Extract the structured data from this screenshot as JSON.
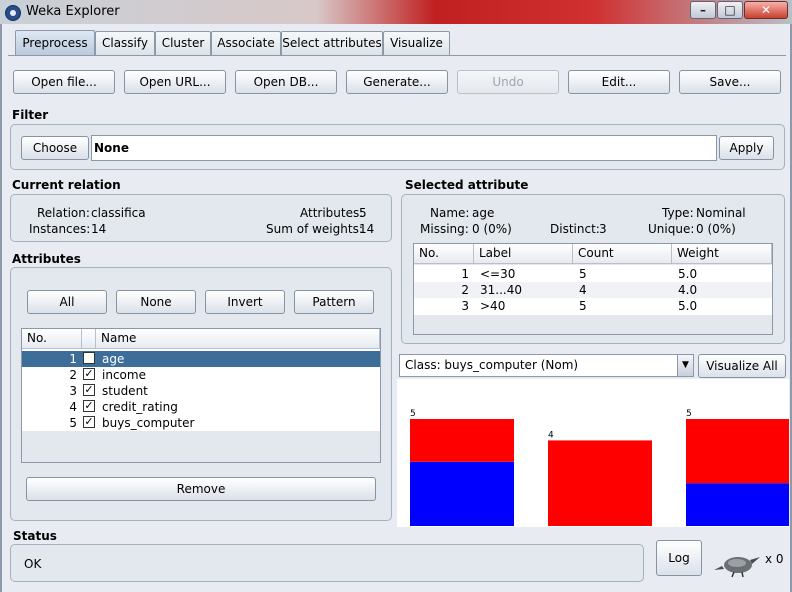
{
  "window": {
    "title": "Weka Explorer"
  },
  "tabs": [
    "Preprocess",
    "Classify",
    "Cluster",
    "Associate",
    "Select attributes",
    "Visualize"
  ],
  "toolbar": {
    "open_file": "Open file...",
    "open_url": "Open URL...",
    "open_db": "Open DB...",
    "generate": "Generate...",
    "undo": "Undo",
    "edit": "Edit...",
    "save": "Save..."
  },
  "filter": {
    "heading": "Filter",
    "choose": "Choose",
    "value": "None",
    "apply": "Apply"
  },
  "relation": {
    "heading": "Current relation",
    "relation_label": "Relation:",
    "relation_value": "classifica",
    "instances_label": "Instances:",
    "instances_value": "14",
    "attributes_label": "Attributes:",
    "attributes_value": "5",
    "weights_label": "Sum of weights:",
    "weights_value": "14"
  },
  "attributes": {
    "heading": "Attributes",
    "all": "All",
    "none": "None",
    "invert": "Invert",
    "pattern": "Pattern",
    "col_no": "No.",
    "col_name": "Name",
    "rows": [
      {
        "no": "1",
        "name": "age",
        "checked": true,
        "selected": true
      },
      {
        "no": "2",
        "name": "income",
        "checked": true,
        "selected": false
      },
      {
        "no": "3",
        "name": "student",
        "checked": true,
        "selected": false
      },
      {
        "no": "4",
        "name": "credit_rating",
        "checked": true,
        "selected": false
      },
      {
        "no": "5",
        "name": "buys_computer",
        "checked": true,
        "selected": false
      }
    ],
    "remove": "Remove"
  },
  "selected": {
    "heading": "Selected attribute",
    "name_label": "Name:",
    "name_value": "age",
    "type_label": "Type:",
    "type_value": "Nominal",
    "missing_label": "Missing:",
    "missing_value": "0 (0%)",
    "distinct_label": "Distinct:",
    "distinct_value": "3",
    "unique_label": "Unique:",
    "unique_value": "0 (0%)",
    "cols": [
      "No.",
      "Label",
      "Count",
      "Weight"
    ],
    "rows": [
      {
        "no": "1",
        "label": "<=30",
        "count": "5",
        "weight": "5.0"
      },
      {
        "no": "2",
        "label": "31...40",
        "count": "4",
        "weight": "4.0"
      },
      {
        "no": "3",
        "label": ">40",
        "count": "5",
        "weight": "5.0"
      }
    ]
  },
  "class_select": {
    "value": "Class: buys_computer (Nom)",
    "visualize_all": "Visualize All"
  },
  "chart_data": {
    "type": "bar",
    "categories": [
      "<=30",
      "31...40",
      ">40"
    ],
    "values": [
      5,
      4,
      5
    ],
    "series": [
      {
        "color": "#0000ff",
        "values": [
          3,
          0,
          2
        ]
      },
      {
        "color": "#ff0000",
        "values": [
          2,
          4,
          3
        ]
      }
    ]
  },
  "status": {
    "heading": "Status",
    "text": "OK",
    "log": "Log",
    "count": "x 0"
  }
}
